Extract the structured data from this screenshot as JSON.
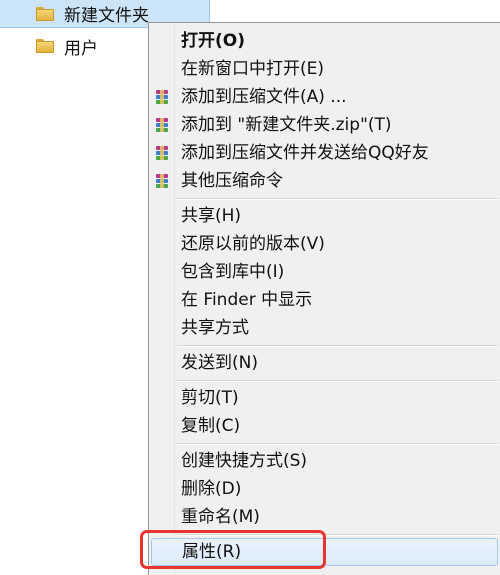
{
  "files": [
    {
      "name": "新建文件夹",
      "selected": true,
      "icon": "folder-icon"
    },
    {
      "name": "用户",
      "selected": false,
      "icon": "folder-icon"
    }
  ],
  "menu": {
    "open": "打开(O)",
    "open_new_window": "在新窗口中打开(E)",
    "add_to_archive": "添加到压缩文件(A) ...",
    "add_to_zip": "添加到 \"新建文件夹.zip\"(T)",
    "add_and_send_qq": "添加到压缩文件并发送给QQ好友",
    "other_compress": "其他压缩命令",
    "share": "共享(H)",
    "restore_versions": "还原以前的版本(V)",
    "include_library": "包含到库中(I)",
    "show_in_finder": "在 Finder 中显示",
    "share_method": "共享方式",
    "send_to": "发送到(N)",
    "cut": "剪切(T)",
    "copy": "复制(C)",
    "create_shortcut": "创建快捷方式(S)",
    "delete": "删除(D)",
    "rename": "重命名(M)",
    "properties": "属性(R)"
  },
  "highlight": {
    "target": "properties",
    "color": "#e8342e"
  },
  "colors": {
    "selection": "#cce4f7",
    "menu_bg": "#f0f0f0",
    "hover": "#dcebfc"
  }
}
